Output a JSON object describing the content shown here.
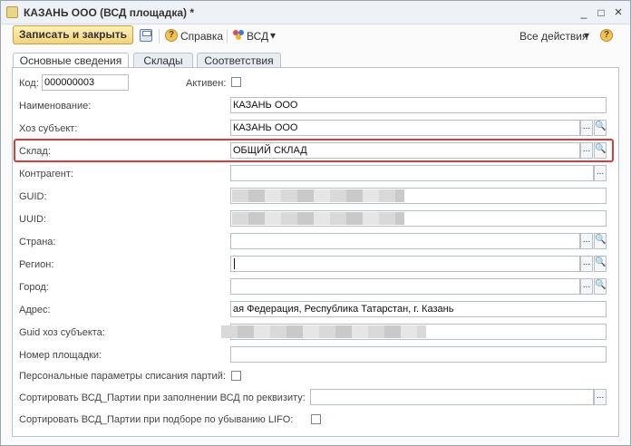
{
  "window": {
    "title": "КАЗАНЬ ООО (ВСД площадка) *",
    "min": "_",
    "max": "□",
    "close": "×"
  },
  "toolbar": {
    "save_close_label": "Записать и закрыть",
    "help_label": "Справка",
    "vsd_label": "ВСД",
    "all_actions_label": "Все действия",
    "help_icon": "?"
  },
  "tabs": [
    {
      "label": "Основные сведения",
      "active": true
    },
    {
      "label": "Склады",
      "active": false
    },
    {
      "label": "Соответствия",
      "active": false
    }
  ],
  "form": {
    "kod_label": "Код:",
    "kod_value": "000000003",
    "aktiven_label": "Активен:",
    "naim_label": "Наименование:",
    "naim_value": "КАЗАНЬ ООО",
    "hoz_label": "Хоз субъект:",
    "hoz_value": "КАЗАНЬ  ООО",
    "sklad_label": "Склад:",
    "sklad_value": "ОБЩИЙ СКЛАД",
    "kontragent_label": "Контрагент:",
    "guid_label": "GUID:",
    "uuid_label": "UUID:",
    "strana_label": "Страна:",
    "region_label": "Регион:",
    "gorod_label": "Город:",
    "adres_label": "Адрес:",
    "adres_value": "ая Федерация, Республика Татарстан, г. Казань",
    "guidhoz_label": "Guid хоз субъекта:",
    "nomer_label": "Номер площадки:",
    "pers_label": "Персональные параметры списания партий:",
    "sort1_label": "Сортировать ВСД_Партии при заполнении ВСД по реквизиту:",
    "sort2_label": "Сортировать ВСД_Партии при подборе по убыванию LIFO:"
  },
  "icons": {
    "select": "...",
    "search": "🔍",
    "dropdown": "▾"
  },
  "colors": {
    "accent": "#f3d27a",
    "highlight": "#d83b3b"
  }
}
